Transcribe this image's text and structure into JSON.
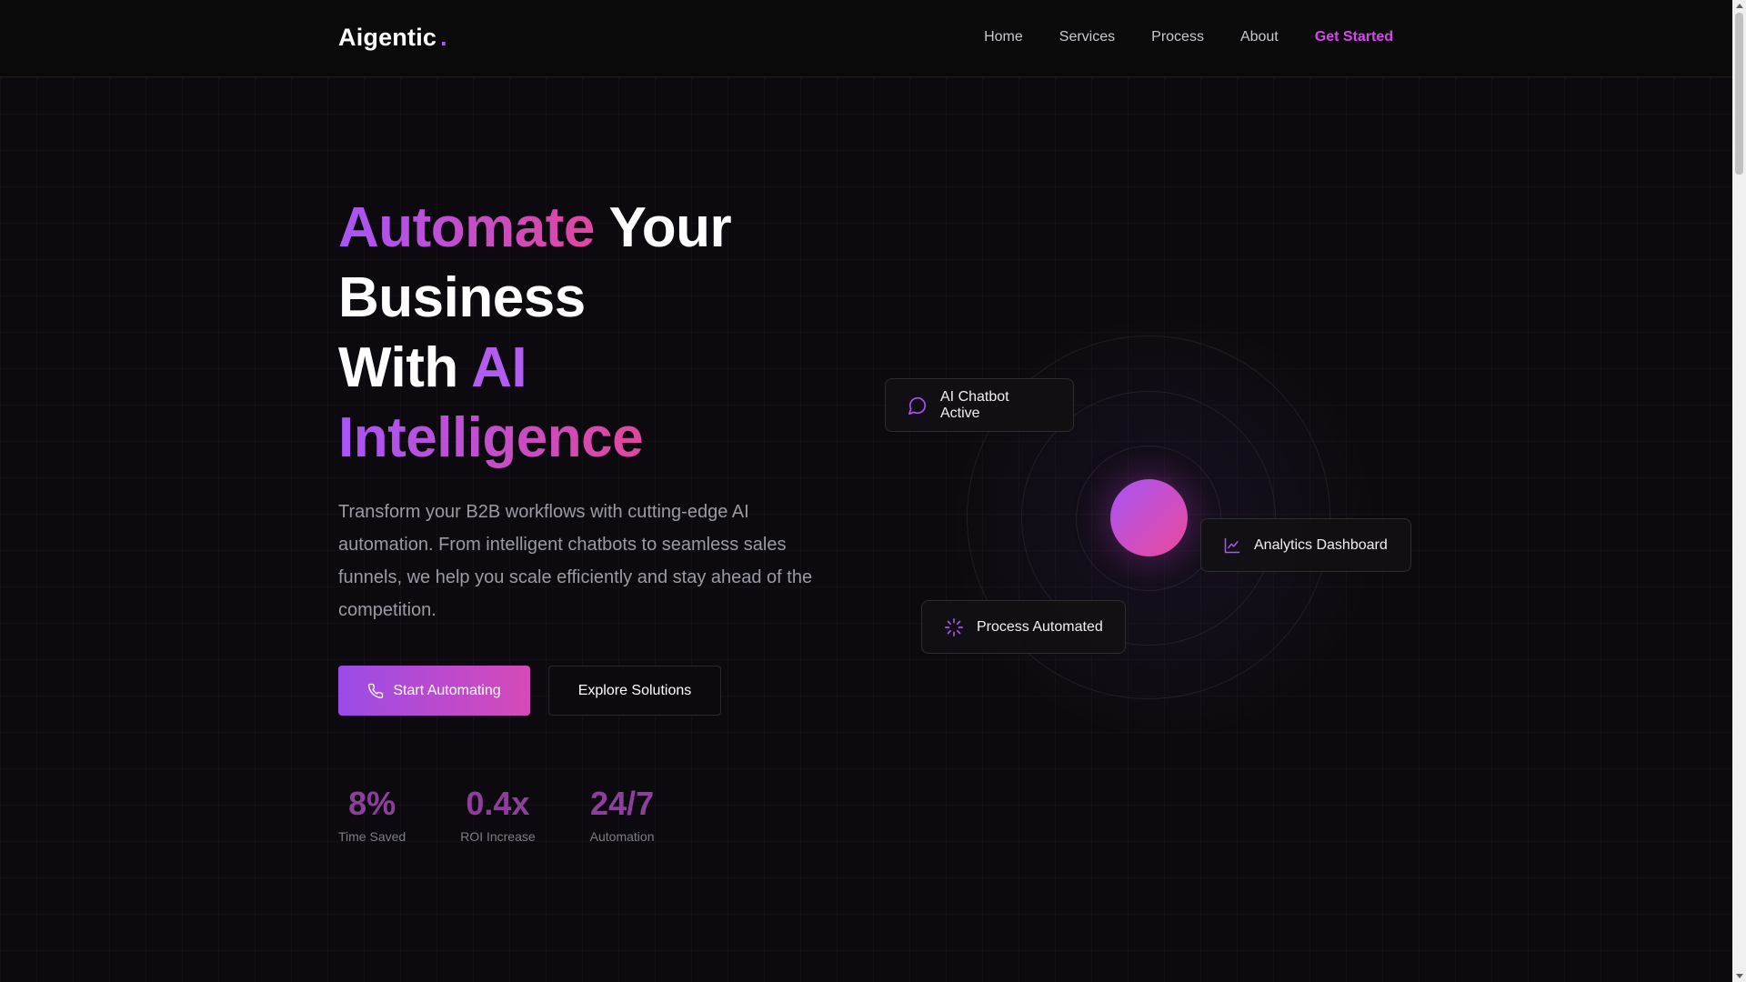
{
  "brand": {
    "name": "Aigentic",
    "dot": "."
  },
  "nav": {
    "items": [
      {
        "label": "Home"
      },
      {
        "label": "Services"
      },
      {
        "label": "Process"
      },
      {
        "label": "About"
      }
    ],
    "cta": "Get Started"
  },
  "hero": {
    "title": {
      "w1": "Automate",
      "w2": "Your",
      "w3": "Business",
      "w4": "With",
      "w5": "AI",
      "w6": "Intelligence"
    },
    "description": "Transform your B2B workflows with cutting-edge AI automation. From intelligent chatbots to seamless sales funnels, we help you scale efficiently and stay ahead of the competition.",
    "primary_button": "Start Automating",
    "secondary_button": "Explore Solutions"
  },
  "stats": [
    {
      "value": "8%",
      "label": "Time Saved"
    },
    {
      "value": "0.4x",
      "label": "ROI Increase"
    },
    {
      "value": "24/7",
      "label": "Automation"
    }
  ],
  "cards": {
    "chatbot": {
      "label": "AI Chatbot Active",
      "icon": "message-circle-icon"
    },
    "analytics": {
      "label": "Analytics Dashboard",
      "icon": "line-chart-icon"
    },
    "process": {
      "label": "Process Automated",
      "icon": "loader-icon"
    }
  },
  "colors": {
    "accent_violet": "#a855f7",
    "accent_pink": "#ec4899",
    "background": "#0c0a0e"
  }
}
